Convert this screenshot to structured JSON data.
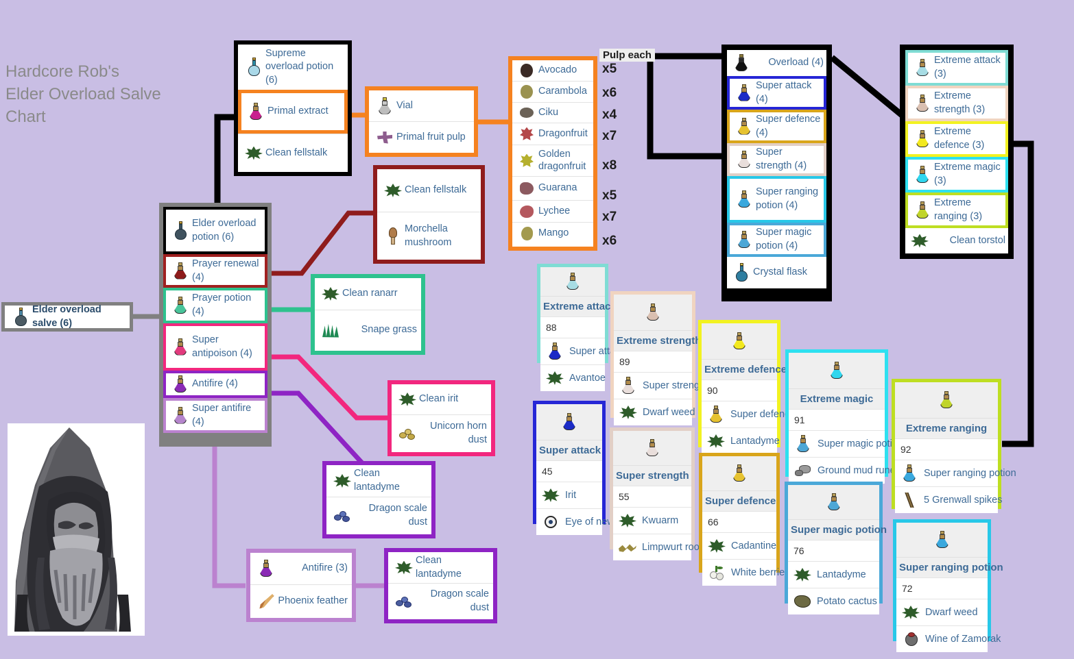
{
  "meta": {
    "title_text": "Hardcore Rob's\nElder Overload Salve\nChart",
    "background": "#c9bee4"
  },
  "final": {
    "label": "Elder overload salve (6)"
  },
  "pulp_header": "Pulp each",
  "top_black_group": {
    "rows": [
      {
        "label": "Supreme overload potion (6)",
        "icon": "potion-cyan",
        "border": "none"
      },
      {
        "label": "Primal extract",
        "icon": "potion-magenta",
        "border": "#f58220"
      },
      {
        "label": "Clean fellstalk",
        "icon": "herb",
        "border": "none"
      }
    ]
  },
  "vial_group": {
    "border": "#f58220",
    "rows": [
      {
        "label": "Vial",
        "icon": "potion-grey"
      },
      {
        "label": "Primal fruit pulp",
        "icon": "pulp"
      }
    ]
  },
  "fruit_group": {
    "border": "#f58220",
    "rows": [
      {
        "label": "Avocado",
        "icon": "fruit-avocado",
        "pulp": "x5"
      },
      {
        "label": "Carambola",
        "icon": "fruit-carambola",
        "pulp": "x6"
      },
      {
        "label": "Ciku",
        "icon": "fruit-ciku",
        "pulp": "x4"
      },
      {
        "label": "Dragonfruit",
        "icon": "fruit-dragonfruit",
        "pulp": "x7"
      },
      {
        "label": "Golden dragonfruit",
        "icon": "fruit-golden-dragonfruit",
        "pulp": "x8"
      },
      {
        "label": "Guarana",
        "icon": "fruit-guarana",
        "pulp": "x5"
      },
      {
        "label": "Lychee",
        "icon": "fruit-lychee",
        "pulp": "x7"
      },
      {
        "label": "Mango",
        "icon": "fruit-mango",
        "pulp": "x6"
      }
    ]
  },
  "elder_group": {
    "rows": [
      {
        "label": "Elder overload potion (6)",
        "icon": "potion-dark",
        "border": "#000000"
      },
      {
        "label": "Prayer renewal (4)",
        "icon": "potion-darkred",
        "border": "#a02020"
      },
      {
        "label": "Prayer potion (4)",
        "icon": "potion-teal",
        "border": "#2ec28e"
      },
      {
        "label": "Super antipoison (4)",
        "icon": "potion-pink",
        "border": "#f2277e"
      },
      {
        "label": "Antifire (4)",
        "icon": "potion-purple",
        "border": "#8e24c4"
      },
      {
        "label": "Super antifire (4)",
        "icon": "potion-lilac",
        "border": "#bb82cf"
      }
    ]
  },
  "fellstalk_morchella": {
    "border": "#a02020",
    "rows": [
      {
        "label": "Clean fellstalk",
        "icon": "herb"
      },
      {
        "label": "Morchella mushroom",
        "icon": "mushroom"
      }
    ]
  },
  "ranarr_snape": {
    "border": "#2ec28e",
    "rows": [
      {
        "label": "Clean ranarr",
        "icon": "herb"
      },
      {
        "label": "Snape grass",
        "icon": "grass"
      }
    ]
  },
  "irit_unicorn": {
    "border": "#f2277e",
    "rows": [
      {
        "label": "Clean irit",
        "icon": "herb"
      },
      {
        "label": "Unicorn horn dust",
        "icon": "dust-gold"
      }
    ]
  },
  "lantadyme_scale_1": {
    "border": "#8e24c4",
    "rows": [
      {
        "label": "Clean lantadyme",
        "icon": "herb"
      },
      {
        "label": "Dragon scale dust",
        "icon": "dust-blue"
      }
    ]
  },
  "antifire3_phoenix": {
    "border": "#bb82cf",
    "rows": [
      {
        "label": "Antifire (3)",
        "icon": "potion-purple"
      },
      {
        "label": "Phoenix feather",
        "icon": "feather"
      }
    ]
  },
  "lantadyme_scale_2": {
    "border": "#8e24c4",
    "rows": [
      {
        "label": "Clean lantadyme",
        "icon": "herb"
      },
      {
        "label": "Dragon scale dust",
        "icon": "dust-blue"
      }
    ]
  },
  "overload_group": {
    "rows": [
      {
        "label": "Overload (4)",
        "icon": "potion-black",
        "border": "none"
      },
      {
        "label": "Super attack (4)",
        "icon": "potion-blue",
        "border": "#2626d6"
      },
      {
        "label": "Super defence (4)",
        "icon": "potion-gold",
        "border": "#d9a51b"
      },
      {
        "label": "Super strength (4)",
        "icon": "potion-white",
        "border": "#e2cfc6"
      },
      {
        "label": "Super ranging potion (4)",
        "icon": "potion-ltblue",
        "border": "#28c8e8"
      },
      {
        "label": "Super magic potion (4)",
        "icon": "potion-ltblue",
        "border": "#4aa8d8"
      },
      {
        "label": "Crystal flask",
        "icon": "flask-crystal",
        "border": "none"
      }
    ]
  },
  "extreme_group": {
    "rows": [
      {
        "label": "Extreme attack (3)",
        "icon": "potion-palecyan",
        "border": "#7fdcd4"
      },
      {
        "label": "Extreme strength (3)",
        "icon": "potion-tan",
        "border": "#f0d4c0"
      },
      {
        "label": "Extreme defence (3)",
        "icon": "potion-yellow",
        "border": "#f2f221"
      },
      {
        "label": "Extreme magic (3)",
        "icon": "potion-cyan2",
        "border": "#2ee0f0"
      },
      {
        "label": "Extreme ranging (3)",
        "icon": "potion-olive",
        "border": "#bede22"
      },
      {
        "label": "Clean torstol",
        "icon": "herb",
        "border": "none"
      }
    ]
  },
  "recipes": [
    {
      "key": "extreme_attack",
      "name": "Extreme attack",
      "level": "88",
      "border": "#7fdcd4",
      "icon": "potion-palecyan",
      "ingredients": [
        {
          "label": "Super attack",
          "icon": "potion-blue"
        },
        {
          "label": "Avantoe",
          "icon": "herb"
        }
      ]
    },
    {
      "key": "extreme_strength",
      "name": "Extreme strength",
      "level": "89",
      "border": "#f0d4c0",
      "icon": "potion-tan",
      "ingredients": [
        {
          "label": "Super strength",
          "icon": "potion-white"
        },
        {
          "label": "Dwarf weed",
          "icon": "herb"
        }
      ]
    },
    {
      "key": "extreme_defence",
      "name": "Extreme defence",
      "level": "90",
      "border": "#f2f221",
      "icon": "potion-yellow",
      "ingredients": [
        {
          "label": "Super defence",
          "icon": "potion-gold"
        },
        {
          "label": "Lantadyme",
          "icon": "herb"
        }
      ]
    },
    {
      "key": "extreme_magic",
      "name": "Extreme magic",
      "level": "91",
      "border": "#2ee0f0",
      "icon": "potion-cyan2",
      "ingredients": [
        {
          "label": "Super magic potion",
          "icon": "potion-ltblue"
        },
        {
          "label": "Ground mud runes",
          "icon": "rock"
        }
      ]
    },
    {
      "key": "extreme_ranging",
      "name": "Extreme ranging",
      "level": "92",
      "border": "#bede22",
      "icon": "potion-olive",
      "ingredients": [
        {
          "label": "Super ranging potion",
          "icon": "potion-ltblue"
        },
        {
          "label": "5 Grenwall spikes",
          "icon": "spikes"
        }
      ]
    },
    {
      "key": "super_attack",
      "name": "Super attack",
      "level": "45",
      "border": "#2626d6",
      "icon": "potion-blue",
      "ingredients": [
        {
          "label": "Irit",
          "icon": "herb"
        },
        {
          "label": "Eye of newt",
          "icon": "newt"
        }
      ]
    },
    {
      "key": "super_strength",
      "name": "Super strength",
      "level": "55",
      "border": "#e2cfc6",
      "icon": "potion-white",
      "ingredients": [
        {
          "label": "Kwuarm",
          "icon": "herb"
        },
        {
          "label": "Limpwurt root",
          "icon": "root"
        }
      ]
    },
    {
      "key": "super_defence",
      "name": "Super defence",
      "level": "66",
      "border": "#d9a51b",
      "icon": "potion-gold",
      "ingredients": [
        {
          "label": "Cadantine",
          "icon": "herb"
        },
        {
          "label": "White berries",
          "icon": "berries"
        }
      ]
    },
    {
      "key": "super_magic",
      "name": "Super magic potion",
      "level": "76",
      "border": "#4aa8d8",
      "icon": "potion-ltblue",
      "ingredients": [
        {
          "label": "Lantadyme",
          "icon": "herb"
        },
        {
          "label": "Potato cactus",
          "icon": "cactus"
        }
      ]
    },
    {
      "key": "super_ranging",
      "name": "Super ranging potion",
      "level": "72",
      "border": "#28c8e8",
      "icon": "potion-ltblue",
      "ingredients": [
        {
          "label": "Dwarf weed",
          "icon": "herb"
        },
        {
          "label": "Wine of Zamorak",
          "icon": "wine"
        }
      ]
    }
  ]
}
